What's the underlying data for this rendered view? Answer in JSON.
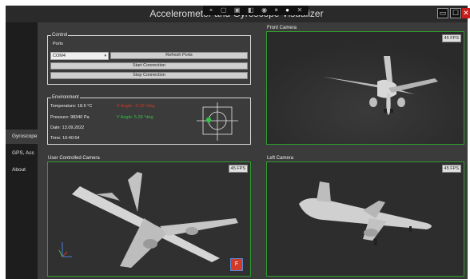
{
  "window": {
    "title": "Accelerometer and Gyroscope Visualizer",
    "toolbar_icons": [
      "pointer-icon",
      "window-icon",
      "screenshot-icon",
      "toggle-icon",
      "record-icon",
      "fps-icon",
      "color-icon",
      "close-toolbar-icon"
    ],
    "buttons": {
      "minimize": "▭",
      "maximize": "☐",
      "close": "✕"
    }
  },
  "sidebar": {
    "items": [
      {
        "label": "Gyroscope",
        "active": true
      },
      {
        "label": "GPS, Acc",
        "active": false
      },
      {
        "label": "About",
        "active": false
      }
    ]
  },
  "control": {
    "title": "Control",
    "port_label": "Ports",
    "port_value": "COM4",
    "refresh_label": "Refresh Ports",
    "start_label": "Start Connection",
    "stop_label": "Stop Connection"
  },
  "environment": {
    "title": "Environment",
    "temperature": "Temperature: 18.6 °C",
    "pressure": "Pressure: 98340 Pa",
    "date": "Date: 13.09.2022",
    "time": "Time: 10:40:54",
    "x_angle": "X Angle: -0.10 °deg",
    "y_angle": "Y Angle: 5.28 °deg",
    "x_color": "#d23a2a",
    "y_color": "#35c24a"
  },
  "cameras": {
    "front": {
      "title": "Front Camera",
      "fps": "45 FPS"
    },
    "user": {
      "title": "User Controlled Camera",
      "fps": "45 FPS"
    },
    "left": {
      "title": "Left Camera",
      "fps": "45 FPS"
    }
  },
  "colors": {
    "accent_green": "#2f9e2f",
    "close_red": "#c81d1d"
  }
}
